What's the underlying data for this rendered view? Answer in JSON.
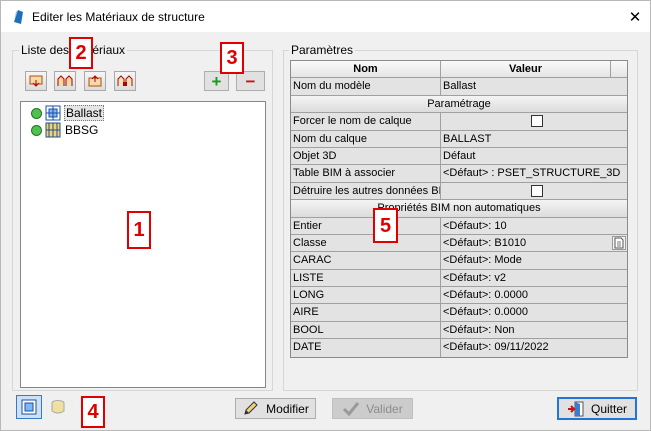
{
  "window": {
    "title": "Editer les Matériaux de structure",
    "close_glyph": "✕"
  },
  "left_panel": {
    "label": "Liste des matériaux",
    "toolbar": [
      "insert-icon",
      "insert-group-icon",
      "import-icon",
      "group-edit-icon"
    ],
    "add_glyph": "+",
    "remove_glyph": "−",
    "tree": [
      {
        "label": "Ballast",
        "icon": "ballast-icon",
        "selected": true
      },
      {
        "label": "BBSG",
        "icon": "bbsg-icon",
        "selected": false
      }
    ]
  },
  "parameters": {
    "label": "Paramètres",
    "header": {
      "name": "Nom",
      "value": "Valeur"
    },
    "model_row": {
      "name": "Nom du modèle",
      "value": "Ballast"
    },
    "section1": "Paramétrage",
    "rows1": [
      {
        "name": "Forcer le nom de calque",
        "value": "",
        "checkbox": true
      },
      {
        "name": "Nom du calque",
        "value": "BALLAST"
      },
      {
        "name": "Objet 3D",
        "value": "Défaut"
      },
      {
        "name": "Table BIM à associer",
        "value": "<Défaut> : PSET_STRUCTURE_3D"
      },
      {
        "name": "Détruire les autres données BI",
        "value": "",
        "checkbox": true
      }
    ],
    "section2": "Propriétés BIM non automatiques",
    "rows2": [
      {
        "name": "Entier",
        "value": "<Défaut>: 10"
      },
      {
        "name": "Classe",
        "value": "<Défaut>: B1010",
        "browse": true
      },
      {
        "name": "CARAC",
        "value": "<Défaut>: Mode"
      },
      {
        "name": "LISTE",
        "value": "<Défaut>: v2"
      },
      {
        "name": "LONG",
        "value": "<Défaut>: 0.0000"
      },
      {
        "name": "AIRE",
        "value": "<Défaut>: 0.0000"
      },
      {
        "name": "BOOL",
        "value": "<Défaut>: Non"
      },
      {
        "name": "DATE",
        "value": "<Défaut>: 09/11/2022"
      }
    ]
  },
  "buttons": {
    "modify": "Modifier",
    "validate": "Valider",
    "quit": "Quitter"
  },
  "annotations": [
    "1",
    "2",
    "3",
    "4",
    "5"
  ],
  "colors": {
    "annotation": "#e00000",
    "accent": "#2474d8",
    "status_dot": "#4ec24e"
  }
}
